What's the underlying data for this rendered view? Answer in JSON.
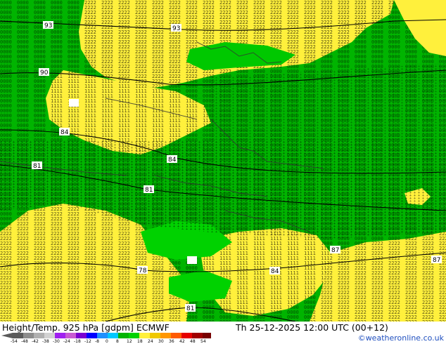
{
  "map": {
    "contour_labels": [
      "93",
      "93",
      "90",
      "84",
      "84",
      "81",
      "81",
      "78",
      "84",
      "87",
      "87",
      "81"
    ]
  },
  "footer": {
    "title": "Height/Temp. 925 hPa [gdpm] ECMWF",
    "valid": "Th 25-12-2025 12:00 UTC (00+12)",
    "credit": "©weatheronline.co.uk"
  },
  "legend": {
    "ticks": [
      "-54",
      "-48",
      "-42",
      "-38",
      "-30",
      "-24",
      "-18",
      "-12",
      "-8",
      "0",
      "8",
      "12",
      "18",
      "24",
      "30",
      "36",
      "42",
      "48",
      "54"
    ],
    "colors": [
      "#5a5a5a",
      "#8c8c8c",
      "#b0b0b0",
      "#d2d2d2",
      "#a020f0",
      "#c85ad2",
      "#7a00d2",
      "#0000ff",
      "#1e90ff",
      "#00c8ff",
      "#00b400",
      "#00d200",
      "#fff03c",
      "#f0c800",
      "#ff9600",
      "#ff5a00",
      "#e60000",
      "#a00000",
      "#780000"
    ]
  },
  "colors": {
    "warm_field": "#fff03c",
    "mild_field": "#00d200",
    "green_field": "#00b400"
  }
}
